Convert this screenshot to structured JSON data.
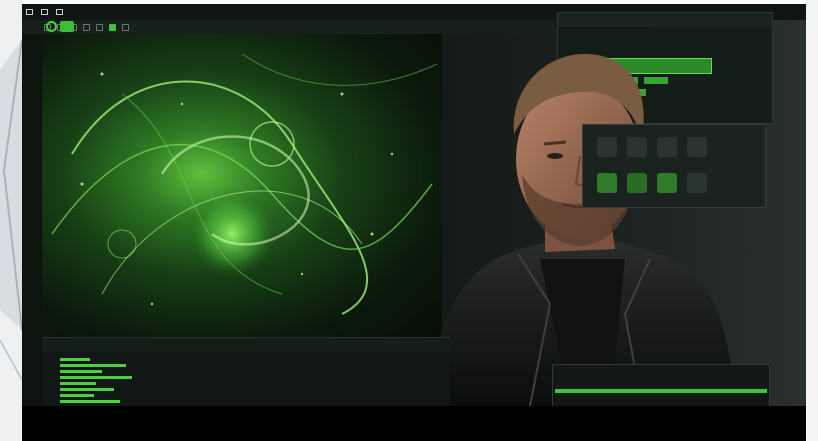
{
  "colors": {
    "accent_green": "#3cc43a",
    "panel_bg": "#1b2320",
    "letterbox": "#000000"
  },
  "menubar": {
    "items": [],
    "icons": [
      "square-icon",
      "grid-icon",
      "chevron-icon"
    ]
  },
  "toolbar": {
    "icons": [
      "ring-icon",
      "play-icon",
      "select-icon",
      "move-icon",
      "rotate-icon",
      "scale-icon",
      "brush-icon"
    ]
  },
  "panel_properties": {
    "rows": [],
    "primary_button": "",
    "secondary_buttons": []
  },
  "panel_assets": {
    "thumbnails": [
      "asset-thumb-1",
      "asset-thumb-2",
      "asset-thumb-3",
      "asset-thumb-4",
      "asset-thumb-5",
      "asset-thumb-6",
      "asset-thumb-7",
      "asset-thumb-8"
    ],
    "labels": []
  },
  "console": {
    "title": "",
    "lines": [
      0.25,
      0.55,
      0.35,
      0.6,
      0.3,
      0.45,
      0.28,
      0.5
    ]
  },
  "timeline": {
    "rows": [],
    "progress": 1.0
  }
}
